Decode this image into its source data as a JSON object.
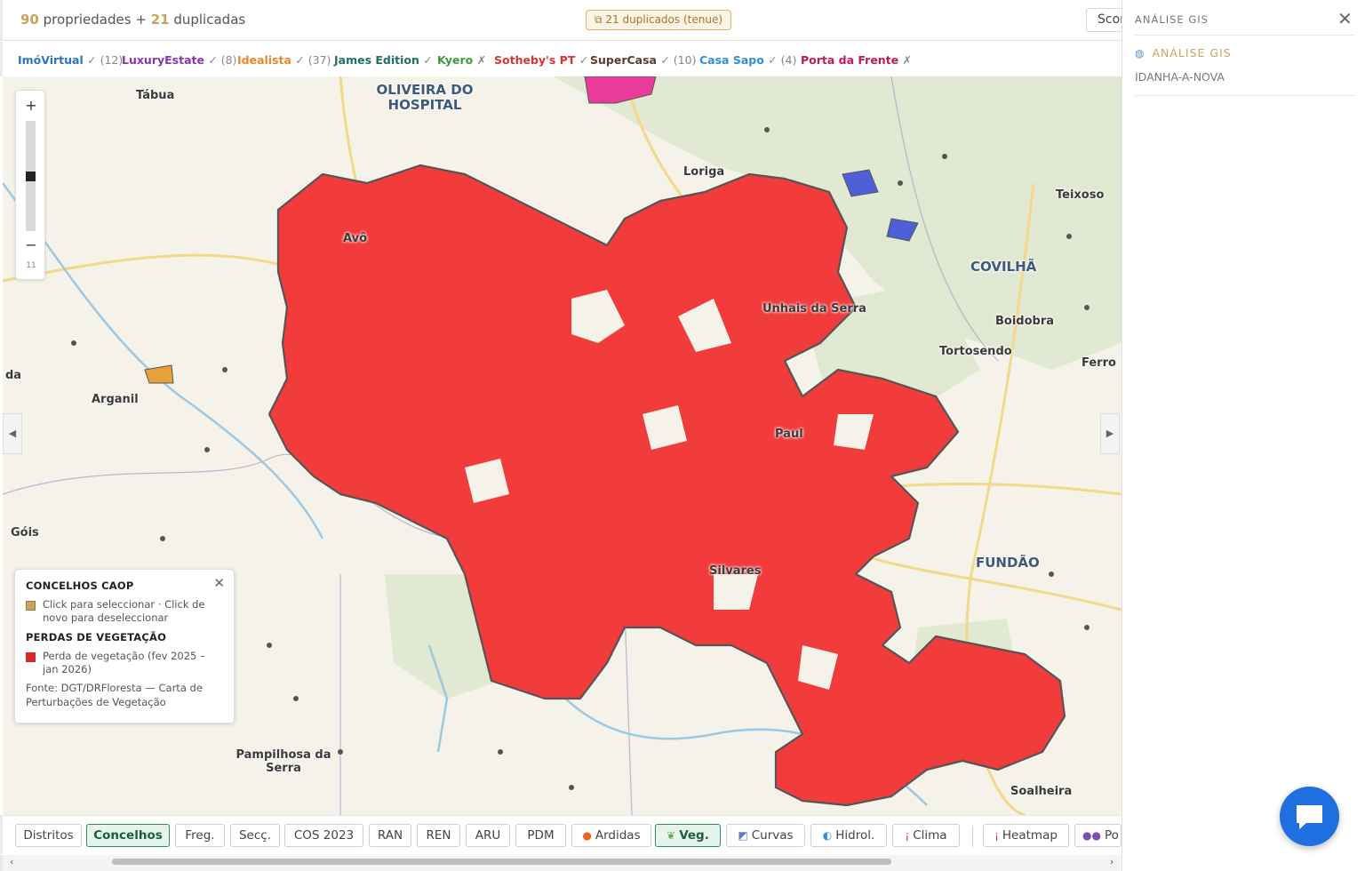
{
  "header": {
    "prop_count": "90",
    "prop_label": "propriedades +",
    "dup_count": "21",
    "dup_label": "duplicadas",
    "dup_badge": "21 duplicados (tenue)",
    "score_label": "Score"
  },
  "sources": [
    {
      "name": "ImóVirtual",
      "meta": "✓ (12)",
      "color": "#2b74c6"
    },
    {
      "name": "LuxuryEstate",
      "meta": "✓ (8)",
      "color": "#8b34b3"
    },
    {
      "name": "Idealista",
      "meta": "✓ (37)",
      "color": "#e8862a"
    },
    {
      "name": "James Edition",
      "meta": "✓",
      "color": "#1f6f62"
    },
    {
      "name": "Kyero",
      "meta": "✗",
      "color": "#3f9a3a"
    },
    {
      "name": "Sotheby's PT",
      "meta": "✓",
      "color": "#d83232"
    },
    {
      "name": "SuperCasa",
      "meta": "✓ (10)",
      "color": "#5a3a2a"
    },
    {
      "name": "Casa Sapo",
      "meta": "✓ (4)",
      "color": "#2f8fd8"
    },
    {
      "name": "Porta da Frente",
      "meta": "✗",
      "color": "#c2185b"
    }
  ],
  "map": {
    "zoom_in": "+",
    "zoom_out": "−",
    "zoom_level": "11",
    "left_arrow": "◀",
    "right_arrow": "▶",
    "places": {
      "tabua": "Tábua",
      "oliveira": "OLIVEIRA DO HOSPITAL",
      "loriga": "Loriga",
      "teixoso": "Teixoso",
      "avo": "Avô",
      "covilha": "COVILHÃ",
      "unhais": "Unhais da Serra",
      "boidobra": "Boidobra",
      "tortosendo": "Tortosendo",
      "ferro": "Ferro",
      "da": "da",
      "arganil": "Arganil",
      "paul": "Paul",
      "gois": "Góis",
      "fundao": "FUNDÃO",
      "silvares": "Silvares",
      "pampilhosa": "Pampilhosa da Serra",
      "soalheira": "Soalheira"
    }
  },
  "legend": {
    "title1": "CONCELHOS CAOP",
    "item1": "Click para seleccionar · Click de novo para deseleccionar",
    "title2": "PERDAS DE VEGETAÇÃO",
    "item2": "Perda de vegetação (fev 2025 – jan 2026)",
    "source": "Fonte: DGT/DRFloresta — Carta de Perturbações de Vegetação",
    "close": "✕",
    "colors": {
      "concelho": "#c9a461",
      "perda": "#d92a2a"
    }
  },
  "toolbar": {
    "buttons": [
      "Distritos",
      "Concelhos",
      "Freg.",
      "Secç.",
      "COS 2023",
      "RAN",
      "REN",
      "ARU",
      "PDM",
      "Ardidas",
      "Veg.",
      "Curvas",
      "Hidrol.",
      "Clima",
      "Heatmap",
      "Po"
    ],
    "active": [
      "Concelhos",
      "Veg."
    ]
  },
  "panel": {
    "title": "ANÁLISE GIS",
    "close": "✕",
    "section": "ANÁLISE GIS",
    "location": "IDANHA-A-NOVA"
  },
  "colors": {
    "accent": "#c9a461",
    "active_green": "#2f8a60",
    "loss_red": "#f23b3b",
    "chat_blue": "#1f6fe0"
  }
}
